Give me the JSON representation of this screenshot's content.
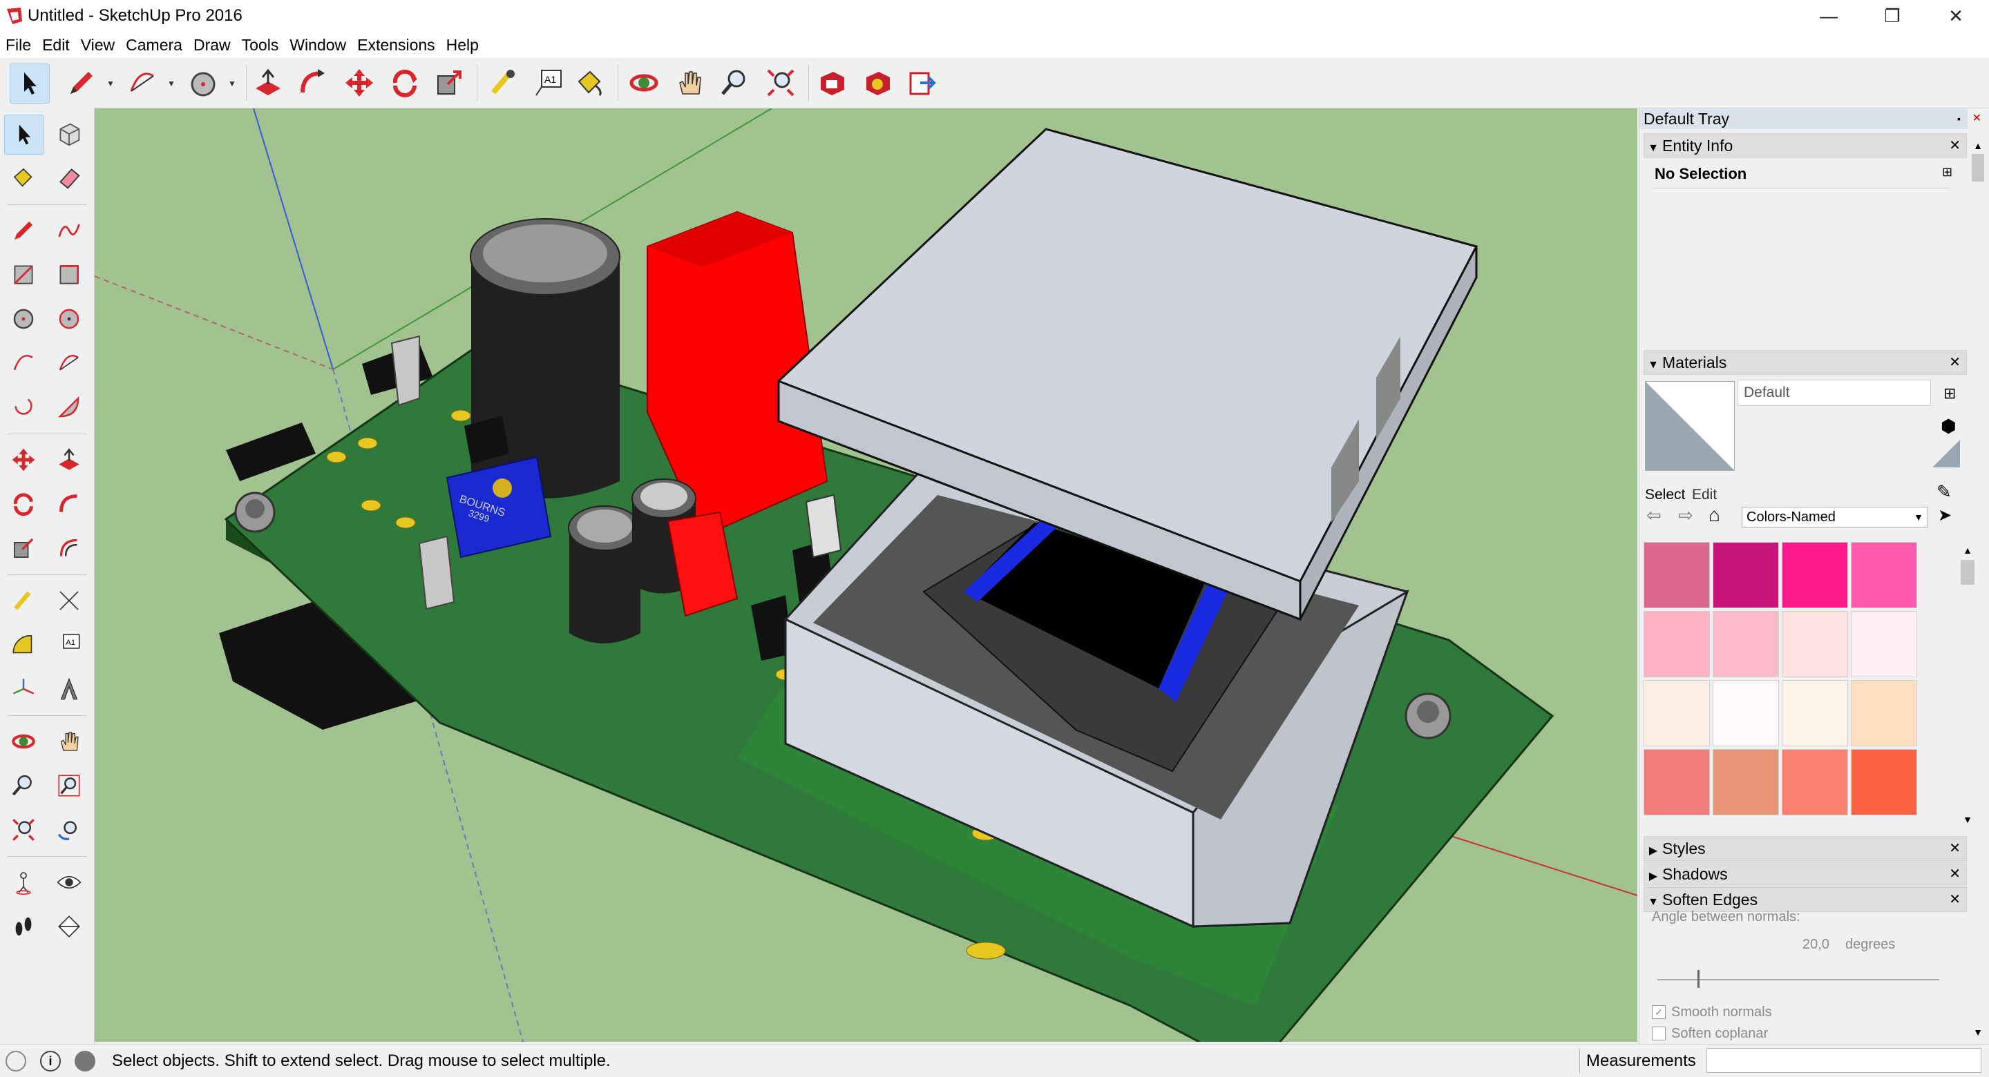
{
  "window": {
    "title": "Untitled - SketchUp Pro 2016",
    "controls": {
      "minimize": "—",
      "restore": "❐",
      "close": "✕"
    }
  },
  "menu": [
    "File",
    "Edit",
    "View",
    "Camera",
    "Draw",
    "Tools",
    "Window",
    "Extensions",
    "Help"
  ],
  "toolbar": [
    {
      "name": "select-tool",
      "icon": "arrow-cursor-icon"
    },
    {
      "name": "line-tool",
      "icon": "pencil-icon"
    },
    {
      "name": "arc-tool",
      "icon": "arc-icon"
    },
    {
      "name": "circle-tool",
      "icon": "circle-icon"
    },
    {
      "name": "push-pull-tool",
      "icon": "push-pull-icon"
    },
    {
      "name": "follow-me-tool",
      "icon": "follow-me-icon"
    },
    {
      "name": "move-tool",
      "icon": "move-arrows-icon"
    },
    {
      "name": "rotate-tool",
      "icon": "rotate-icon"
    },
    {
      "name": "scale-tool",
      "icon": "scale-icon"
    },
    {
      "name": "tape-measure-tool",
      "icon": "tape-measure-icon"
    },
    {
      "name": "text-tool",
      "icon": "text-a1-icon"
    },
    {
      "name": "paint-bucket-tool",
      "icon": "paint-bucket-icon"
    },
    {
      "name": "orbit-tool",
      "icon": "orbit-icon"
    },
    {
      "name": "pan-tool",
      "icon": "hand-icon"
    },
    {
      "name": "zoom-tool",
      "icon": "magnifier-icon"
    },
    {
      "name": "zoom-extents-tool",
      "icon": "zoom-extents-icon"
    },
    {
      "name": "3d-warehouse",
      "icon": "warehouse-icon"
    },
    {
      "name": "extension-warehouse",
      "icon": "extension-warehouse-icon"
    },
    {
      "name": "send-to-layout",
      "icon": "layout-icon"
    }
  ],
  "tray": {
    "title": "Default Tray",
    "entity_info": {
      "label": "Entity Info",
      "selection": "No Selection"
    },
    "materials": {
      "label": "Materials",
      "material_name": "Default",
      "tab_select": "Select",
      "tab_edit": "Edit",
      "library": "Colors-Named",
      "swatches": [
        "#d9688c",
        "#c8157c",
        "#ff1a8c",
        "#ff5cac",
        "#ffb2c2",
        "#ffb8cc",
        "#ffe3e1",
        "#fff0f4",
        "#fcf0e4",
        "#fffafa",
        "#fff4ea",
        "#ffe0c0",
        "#ef7b7b",
        "#e99477",
        "#fa8070",
        "#fe6245"
      ]
    },
    "styles_label": "Styles",
    "shadows_label": "Shadows",
    "soften_edges": {
      "label": "Soften Edges",
      "angle_label": "Angle between normals:",
      "angle_value": "20,0",
      "angle_unit": "degrees",
      "smooth_normals": "Smooth normals",
      "soften_coplanar": "Soften coplanar"
    }
  },
  "status": {
    "message": "Select objects. Shift to extend select. Drag mouse to select multiple.",
    "measurements_label": "Measurements"
  },
  "model": {
    "component_label": "BOURNS",
    "component_code": "3299"
  }
}
